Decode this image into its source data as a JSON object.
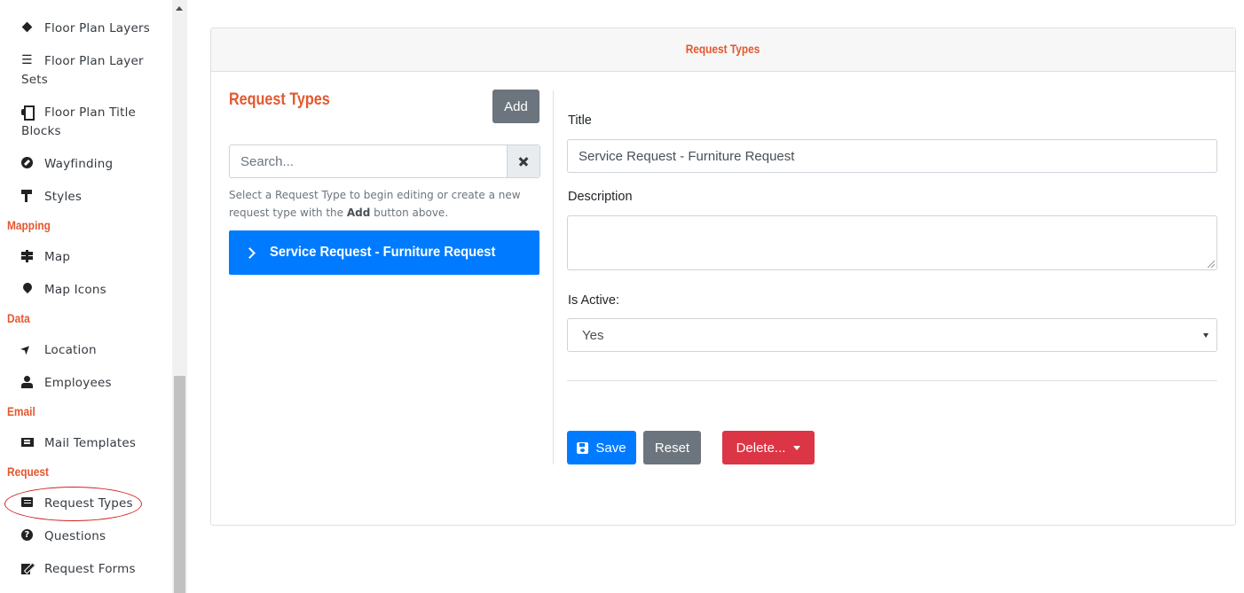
{
  "sidebar": {
    "items": [
      {
        "label": "Floor Plan Layers",
        "icon": "layers-icon"
      },
      {
        "label": "Floor Plan Layer Sets",
        "icon": "list-icon"
      },
      {
        "label": "Floor Plan Title Blocks",
        "icon": "print-icon"
      },
      {
        "label": "Wayfinding",
        "icon": "compass-icon"
      },
      {
        "label": "Styles",
        "icon": "paint-roller-icon"
      },
      {
        "label": "Map",
        "icon": "signs-icon"
      },
      {
        "label": "Map Icons",
        "icon": "map-marker-icon"
      },
      {
        "label": "Location",
        "icon": "location-arrow-icon"
      },
      {
        "label": "Employees",
        "icon": "user-tie-icon"
      },
      {
        "label": "Mail Templates",
        "icon": "mail-bulk-icon"
      },
      {
        "label": "Request Types",
        "icon": "table-list-icon"
      },
      {
        "label": "Questions",
        "icon": "question-circle-icon"
      },
      {
        "label": "Request Forms",
        "icon": "file-signature-icon"
      }
    ],
    "sections": [
      "Mapping",
      "Data",
      "Email",
      "Request"
    ]
  },
  "card": {
    "header": "Request Types",
    "list_panel": {
      "title": "Request Types",
      "add_label": "Add",
      "search_placeholder": "Search...",
      "help_pre": "Select a Request Type to begin editing or create a new request type with the ",
      "help_bold": "Add",
      "help_post": " button above.",
      "items": [
        "Service Request - Furniture Request"
      ]
    },
    "form": {
      "title_label": "Title",
      "title_value": "Service Request - Furniture Request",
      "description_label": "Description",
      "description_value": "",
      "active_label": "Is Active:",
      "active_value": "Yes",
      "save_label": "Save",
      "reset_label": "Reset",
      "delete_label": "Delete..."
    }
  },
  "colors": {
    "accent": "#e4572e",
    "primary": "#007bff",
    "secondary": "#6c757d",
    "danger": "#dc3545",
    "annotation": "#d02020"
  }
}
